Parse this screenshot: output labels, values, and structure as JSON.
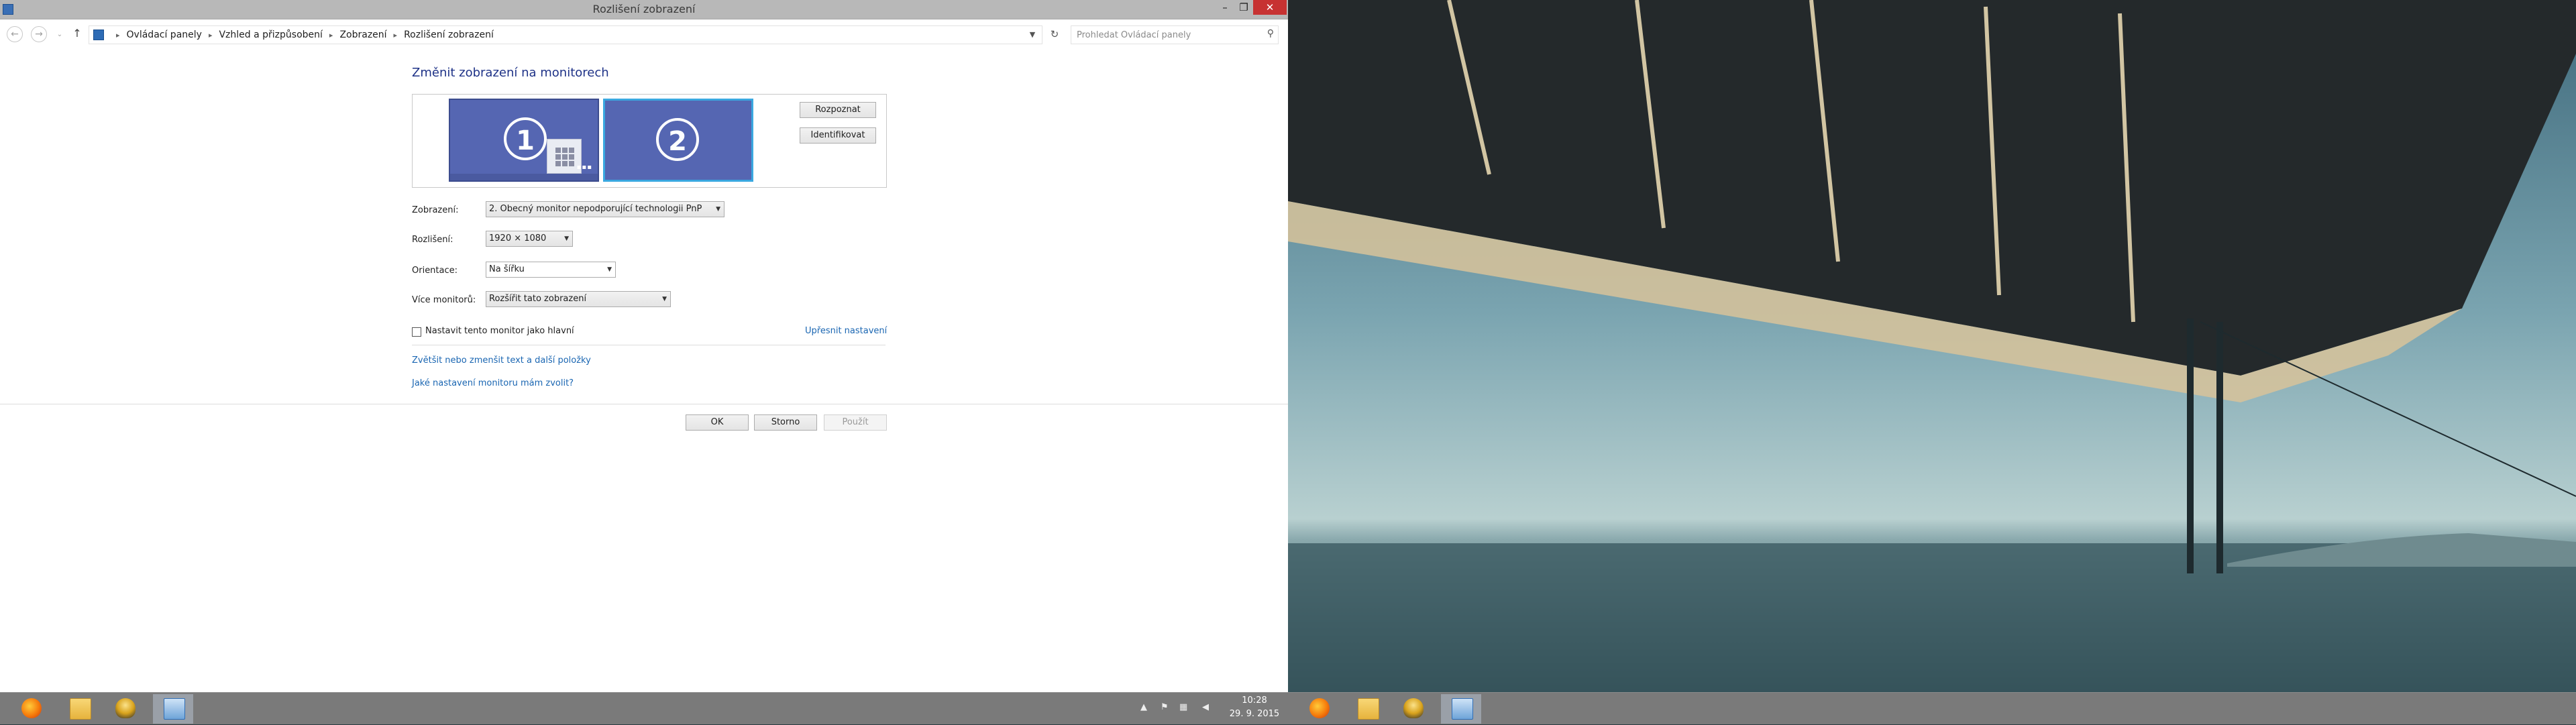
{
  "window": {
    "title": "Rozlišení zobrazení",
    "controls": {
      "minimize": "–",
      "maximize": "❐",
      "close": "✕"
    }
  },
  "addressbar": {
    "breadcrumb": [
      "Ovládací panely",
      "Vzhled a přizpůsobení",
      "Zobrazení",
      "Rozlišení zobrazení"
    ],
    "search_placeholder": "Prohledat Ovládací panely"
  },
  "content": {
    "title": "Změnit zobrazení na monitorech",
    "monitors": [
      "1",
      "2"
    ],
    "selected_monitor": "2",
    "detect_label": "Rozpoznat",
    "identify_label": "Identifikovat",
    "fields": {
      "display": {
        "label": "Zobrazení:",
        "value": "2. Obecný monitor nepodporující technologii PnP"
      },
      "resolution": {
        "label": "Rozlišení:",
        "value": "1920 × 1080"
      },
      "orientation": {
        "label": "Orientace:",
        "value": "Na šířku"
      },
      "multiple": {
        "label": "Více monitorů:",
        "value": "Rozšířit tato zobrazení"
      }
    },
    "primary_checkbox": {
      "label": "Nastavit tento monitor jako hlavní",
      "checked": false
    },
    "advanced_link": "Upřesnit nastavení",
    "text_size_link": "Zvětšit nebo zmenšit text a další položky",
    "monitor_help_link": "Jaké nastavení monitoru mám zvolit?",
    "buttons": {
      "ok": "OK",
      "cancel": "Storno",
      "apply": "Použít"
    }
  },
  "taskbar": {
    "apps": [
      "firefox-icon",
      "file-explorer-icon",
      "fl-studio-icon",
      "control-panel-icon"
    ],
    "active_app": "control-panel-icon",
    "clock_time": "10:28",
    "clock_date": "29. 9. 2015"
  }
}
